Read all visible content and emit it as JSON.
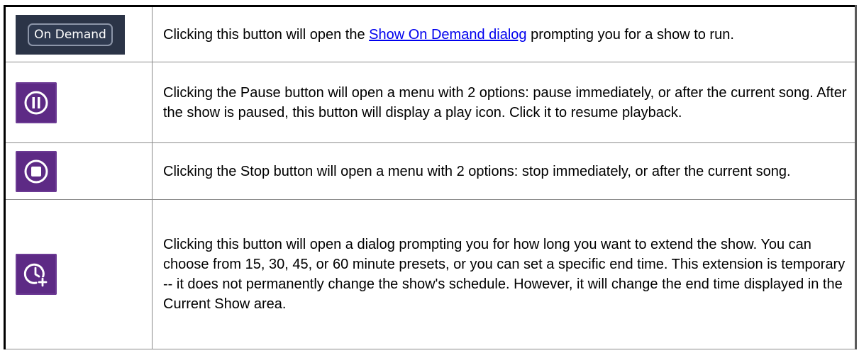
{
  "rows": [
    {
      "button_label": "On Demand",
      "icon": "on-demand-button",
      "text_before": "Clicking this button will open the ",
      "link": "Show On Demand dialog",
      "text_after": " prompting you for a show to run."
    },
    {
      "icon": "pause-icon",
      "text": "Clicking the Pause button will open a menu with 2 options: pause immediately, or after the current song. After the show is paused, this button will display a play icon. Click it to resume playback."
    },
    {
      "icon": "stop-icon",
      "text": "Clicking the Stop button will open a menu with 2 options: stop immediately, or after the current song."
    },
    {
      "icon": "clock-plus-icon",
      "text": "Clicking this button will open a dialog prompting you for how long you want to extend the show. You can choose from 15, 30, 45, or 60 minute presets, or you can set a specific end time. This extension is temporary -- it does not permanently change the show's schedule. However, it will change the end time displayed in the Current Show area."
    }
  ],
  "colors": {
    "icon_tile": "#5d2a85",
    "on_demand_bg": "#2b3447",
    "link": "#0000ee"
  }
}
